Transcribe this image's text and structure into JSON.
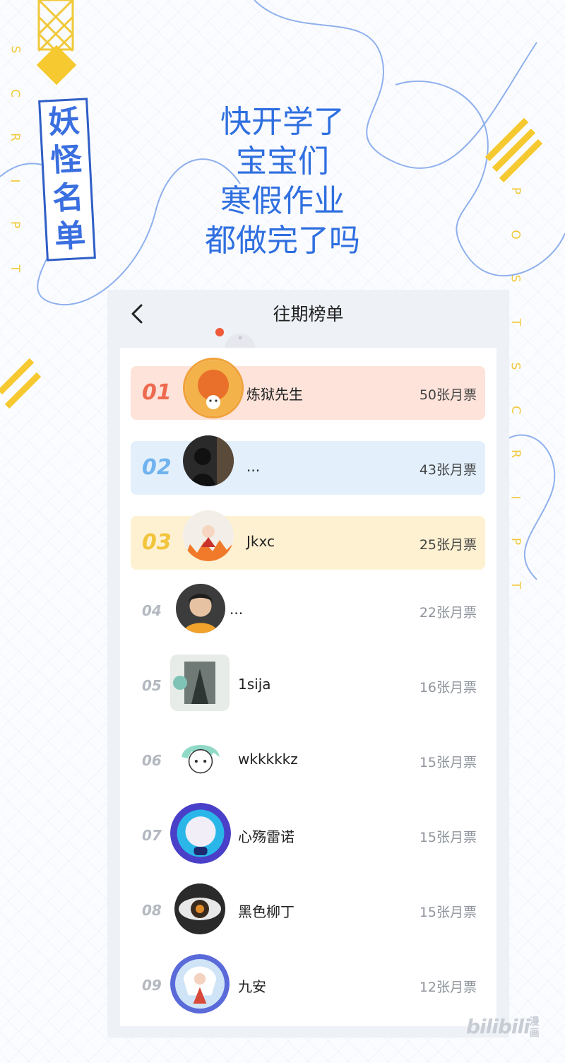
{
  "decor": {
    "left_letters": [
      "S",
      "C",
      "R",
      "I",
      "P",
      "T"
    ],
    "right_letters": [
      "P",
      "O",
      "S",
      "T",
      "S",
      "C",
      "R",
      "I",
      "P",
      "T"
    ],
    "logo_chars": [
      "妖",
      "怪",
      "名",
      "单"
    ]
  },
  "headline": {
    "lines": [
      "快开学了",
      "宝宝们",
      "寒假作业",
      "都做完了吗"
    ]
  },
  "header": {
    "title": "往期榜单"
  },
  "ranking": [
    {
      "rank": "01",
      "name": "炼狱先生",
      "votes": "50张月票"
    },
    {
      "rank": "02",
      "name": "...",
      "votes": "43张月票"
    },
    {
      "rank": "03",
      "name": "Jkxc",
      "votes": "25张月票"
    },
    {
      "rank": "04",
      "name": "...",
      "votes": "22张月票"
    },
    {
      "rank": "05",
      "name": "1sija",
      "votes": "16张月票"
    },
    {
      "rank": "06",
      "name": "wkkkkkz",
      "votes": "15张月票"
    },
    {
      "rank": "07",
      "name": "心殇雷诺",
      "votes": "15张月票"
    },
    {
      "rank": "08",
      "name": "黑色柳丁",
      "votes": "15张月票"
    },
    {
      "rank": "09",
      "name": "九安",
      "votes": "12张月票"
    }
  ],
  "colors": {
    "rank1_bg": "#fde3da",
    "rank1_num": "#ee6a4f",
    "rank2_bg": "#e3f0fc",
    "rank2_num": "#6fb2ee",
    "rank3_bg": "#fdf1d2",
    "rank3_num": "#f2c43a",
    "headline": "#2f6fe0"
  },
  "watermark": {
    "brand": "bilibili",
    "tag": "漫画"
  }
}
